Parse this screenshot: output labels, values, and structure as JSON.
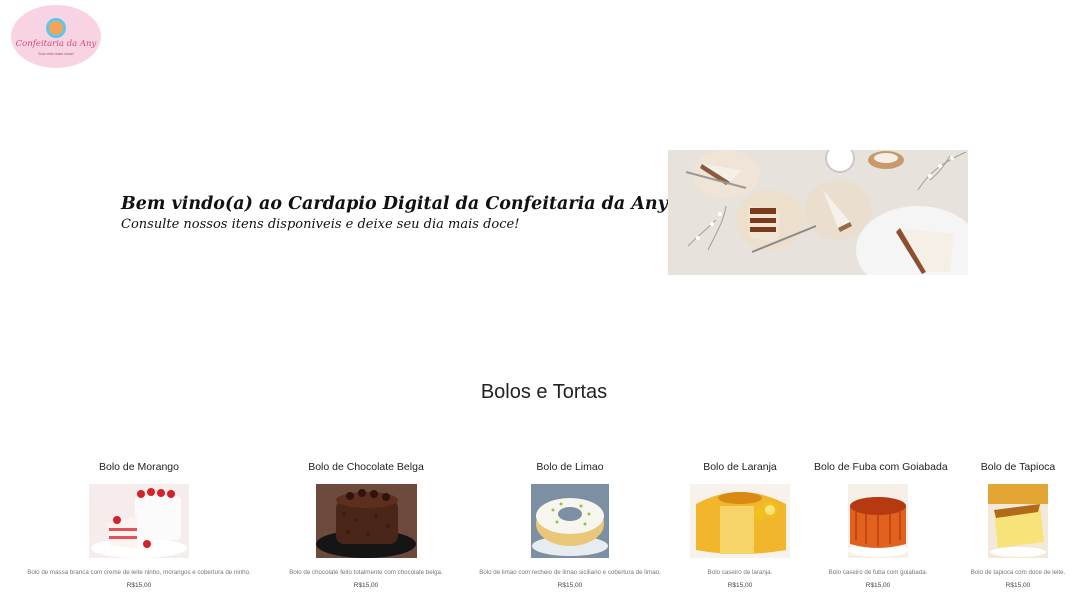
{
  "logo": {
    "name": "Confeitaria da Any",
    "tagline": "Sua vida mais doce!"
  },
  "hero": {
    "title": "Bem vindo(a) ao Cardapio Digital da Confeitaria da Any",
    "subtitle": "Consulte nossos itens disponiveis e deixe seu dia mais doce!"
  },
  "section": {
    "title": "Bolos e Tortas"
  },
  "products": [
    {
      "name": "Bolo de Morango",
      "description": "Bolo de massa branca com creme de leite ninho, morangos e cobertura de ninho.",
      "price": "R$15,00"
    },
    {
      "name": "Bolo de Chocolate Belga",
      "description": "Bolo de chocolate feito totalmente com chocolate belga.",
      "price": "R$15,00"
    },
    {
      "name": "Bolo de Limao",
      "description": "Bolo de limao com recheio de limao siciliano e cobertura de limao.",
      "price": "R$15,00"
    },
    {
      "name": "Bolo de Laranja",
      "description": "Bolo caseiro de laranja.",
      "price": "R$15,00"
    },
    {
      "name": "Bolo de Fuba com Goiabada",
      "description": "Bolo caseiro de fuba com goiabada.",
      "price": "R$15,00"
    },
    {
      "name": "Bolo de Tapioca",
      "description": "Bolo de tapioca com doce de leite.",
      "price": "R$15,00"
    }
  ],
  "colors": {
    "logo_bg": "#f8d3e3",
    "logo_text": "#d04d7a"
  }
}
